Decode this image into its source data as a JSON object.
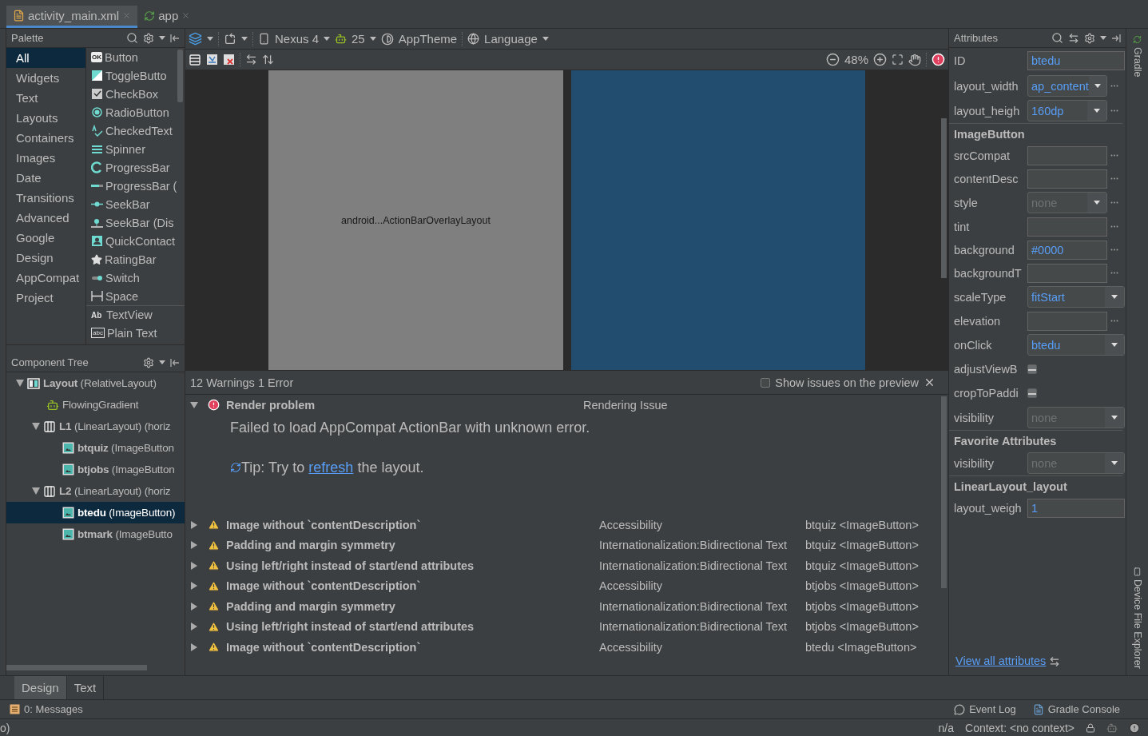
{
  "editor_tabs": [
    {
      "label": "activity_main.xml",
      "selected": true,
      "kind": "xml"
    },
    {
      "label": "app",
      "selected": false,
      "kind": "module"
    }
  ],
  "palette": {
    "title": "Palette",
    "categories": [
      {
        "label": "All",
        "selected": true
      },
      {
        "label": "Widgets",
        "selected": false
      },
      {
        "label": "Text",
        "selected": false
      },
      {
        "label": "Layouts",
        "selected": false
      },
      {
        "label": "Containers",
        "selected": false
      },
      {
        "label": "Images",
        "selected": false
      },
      {
        "label": "Date",
        "selected": false
      },
      {
        "label": "Transitions",
        "selected": false
      },
      {
        "label": "Advanced",
        "selected": false
      },
      {
        "label": "Google",
        "selected": false
      },
      {
        "label": "Design",
        "selected": false
      },
      {
        "label": "AppCompat",
        "selected": false
      },
      {
        "label": "Project",
        "selected": false
      }
    ],
    "widgets": [
      {
        "label": "Button",
        "kind": "ok",
        "icon_text": "OK"
      },
      {
        "label": "ToggleButto",
        "kind": "toggle"
      },
      {
        "label": "CheckBox",
        "kind": "checkbox"
      },
      {
        "label": "RadioButton",
        "kind": "radio"
      },
      {
        "label": "CheckedText",
        "kind": "checkedtext"
      },
      {
        "label": "Spinner",
        "kind": "spinner"
      },
      {
        "label": "ProgressBar",
        "kind": "ring"
      },
      {
        "label": "ProgressBar (",
        "kind": "bar"
      },
      {
        "label": "SeekBar",
        "kind": "seek"
      },
      {
        "label": "SeekBar (Dis",
        "kind": "seekdisc"
      },
      {
        "label": "QuickContact",
        "kind": "contact"
      },
      {
        "label": "RatingBar",
        "kind": "star"
      },
      {
        "label": "Switch",
        "kind": "switch"
      },
      {
        "label": "Space",
        "kind": "space"
      },
      {
        "label": "TextView",
        "kind": "ab",
        "icon_text": "Ab",
        "divider": true
      },
      {
        "label": "Plain Text",
        "kind": "abc",
        "icon_text": "abc"
      }
    ]
  },
  "design_toolbar": {
    "device": "Nexus 4",
    "api": "25",
    "theme": "AppTheme",
    "language": "Language",
    "zoom": "48%"
  },
  "canvas": {
    "design_label": "android...ActionBarOverlayLayout"
  },
  "component_tree": {
    "title": "Component Tree",
    "items": [
      {
        "label": "**Layout** (RelativeLayout)",
        "kind": "relative",
        "selected": false,
        "expanded": true,
        "children": [
          {
            "label": "FlowingGradient",
            "kind": "android",
            "selected": false
          },
          {
            "label": "**L1** (LinearLayout) (horiz",
            "kind": "linear",
            "selected": false,
            "expanded": true,
            "children": [
              {
                "label": "**btquiz** (ImageButton",
                "kind": "image",
                "selected": false
              },
              {
                "label": "**btjobs** (ImageButton",
                "kind": "image",
                "selected": false
              }
            ]
          },
          {
            "label": "**L2** (LinearLayout) (horiz",
            "kind": "linear",
            "selected": false,
            "expanded": true,
            "children": [
              {
                "label": "**btedu** (ImageButton)",
                "kind": "image",
                "selected": true
              },
              {
                "label": "**btmark** (ImageButto",
                "kind": "image",
                "selected": false
              }
            ]
          }
        ]
      }
    ]
  },
  "issues": {
    "summary": "12 Warnings 1 Error",
    "show_on_preview": {
      "label": "Show issues on the preview",
      "checked": false
    },
    "error": {
      "title": "Render problem",
      "category": "Rendering Issue",
      "message": "Failed to load AppCompat ActionBar with unknown error.",
      "tip": "Tip: Try to ",
      "link": "refresh",
      "tip_end": " the layout."
    },
    "rows": [
      {
        "title": "Image without `contentDescription`",
        "category": "Accessibility",
        "component": "btquiz <ImageButton>"
      },
      {
        "title": "Padding and margin symmetry",
        "category": "Internationalization:Bidirectional Text",
        "component": "btquiz <ImageButton>"
      },
      {
        "title": "Using left/right instead of start/end attributes",
        "category": "Internationalization:Bidirectional Text",
        "component": "btquiz <ImageButton>"
      },
      {
        "title": "Image without `contentDescription`",
        "category": "Accessibility",
        "component": "btjobs <ImageButton>"
      },
      {
        "title": "Padding and margin symmetry",
        "category": "Internationalization:Bidirectional Text",
        "component": "btjobs <ImageButton>"
      },
      {
        "title": "Using left/right instead of start/end attributes",
        "category": "Internationalization:Bidirectional Text",
        "component": "btjobs <ImageButton>"
      },
      {
        "title": "Image without `contentDescription`",
        "category": "Accessibility",
        "component": "btedu <ImageButton>"
      }
    ]
  },
  "attributes": {
    "title": "Attributes",
    "rows": [
      {
        "kind": "field",
        "label": "ID",
        "value": "btedu",
        "more": false
      },
      {
        "kind": "dropdown",
        "label": "layout_width",
        "value": "ap_content",
        "more": true
      },
      {
        "kind": "dropdown",
        "label": "layout_heigh",
        "value": "160dp",
        "more": true
      },
      {
        "kind": "section",
        "label": "ImageButton"
      },
      {
        "kind": "field",
        "label": "srcCompat",
        "more": true
      },
      {
        "kind": "field",
        "label": "contentDesc",
        "more": true
      },
      {
        "kind": "dropdown",
        "label": "style",
        "placeholder": "none",
        "more": true
      },
      {
        "kind": "field",
        "label": "tint",
        "more": true
      },
      {
        "kind": "field",
        "label": "background",
        "value": "#0000",
        "more": true
      },
      {
        "kind": "field",
        "label": "backgroundT",
        "more": true
      },
      {
        "kind": "dropdown",
        "label": "scaleType",
        "value": "fitStart",
        "more": false
      },
      {
        "kind": "field",
        "label": "elevation",
        "more": true
      },
      {
        "kind": "dropdown",
        "label": "onClick",
        "value": "btedu",
        "more": false
      },
      {
        "kind": "checkbox",
        "label": "adjustViewB",
        "indeterminate": true
      },
      {
        "kind": "checkbox",
        "label": "cropToPaddi",
        "indeterminate": true
      },
      {
        "kind": "dropdown",
        "label": "visibility",
        "placeholder": "none",
        "more": false
      },
      {
        "kind": "section",
        "label": "Favorite Attributes"
      },
      {
        "kind": "dropdown",
        "label": "visibility",
        "placeholder": "none",
        "more": false
      },
      {
        "kind": "section",
        "label": "LinearLayout_layout"
      },
      {
        "kind": "field",
        "label": "layout_weigh",
        "value": "1",
        "more": false
      }
    ],
    "link": "View all attributes"
  },
  "side_tools": [
    "Gradle",
    "Device File Explorer"
  ],
  "bottom_tabs": [
    {
      "label": "Design",
      "selected": true
    },
    {
      "label": "Text",
      "selected": false
    }
  ],
  "tool_windows": {
    "messages": "0: Messages",
    "event_log": "Event Log",
    "gradle_console": "Gradle Console"
  },
  "status_bar": {
    "left": "o)",
    "position": "n/a",
    "context": "Context: <no context>"
  }
}
